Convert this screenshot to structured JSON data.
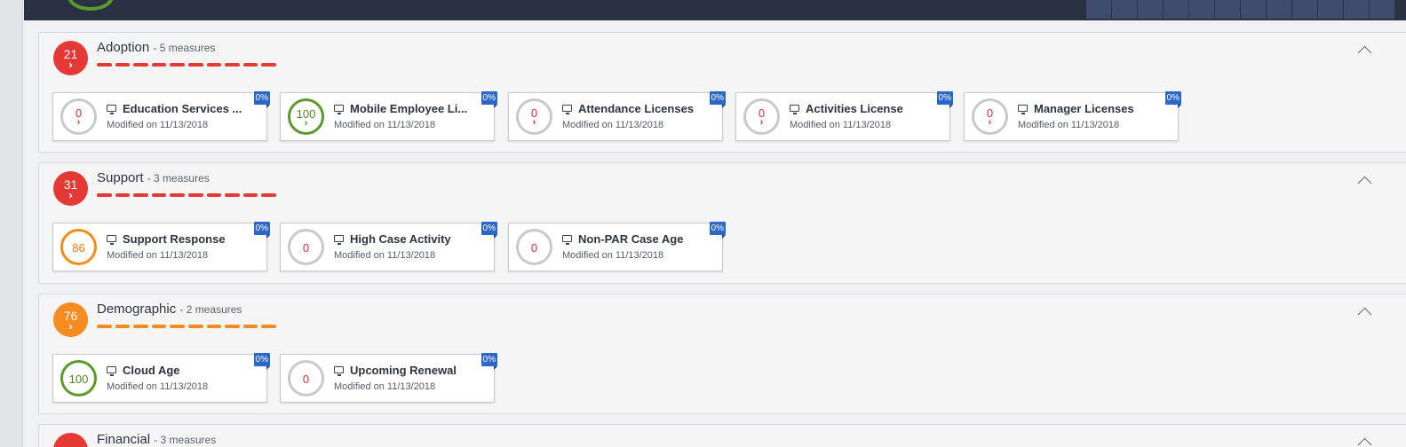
{
  "colors": {
    "red": "#e53935",
    "orange": "#f68b1f",
    "green": "#5b9a2e",
    "blue_tag": "#2a67c8"
  },
  "sections": [
    {
      "score": "21",
      "name": "Adoption",
      "measures": "- 5 measures",
      "color": "#e53935",
      "cards": [
        {
          "score": "0",
          "title": "Education Services ...",
          "modified": "Modified on 11/13/2018",
          "pct": "0%"
        },
        {
          "score": "100",
          "title": "Mobile Employee Li...",
          "modified": "Modified on 11/13/2018",
          "pct": "0%"
        },
        {
          "score": "0",
          "title": "Attendance Licenses",
          "modified": "Modified on 11/13/2018",
          "pct": "0%"
        },
        {
          "score": "0",
          "title": "Activities License",
          "modified": "Modified on 11/13/2018",
          "pct": "0%"
        },
        {
          "score": "0",
          "title": "Manager Licenses",
          "modified": "Modified on 11/13/2018",
          "pct": "0%"
        }
      ]
    },
    {
      "score": "31",
      "name": "Support",
      "measures": "- 3 measures",
      "color": "#e53935",
      "cards": [
        {
          "score": "86",
          "title": "Support Response",
          "modified": "Modified on 11/13/2018",
          "pct": "0%"
        },
        {
          "score": "0",
          "title": "High Case Activity",
          "modified": "Modified on 11/13/2018",
          "pct": "0%"
        },
        {
          "score": "0",
          "title": "Non-PAR Case Age",
          "modified": "Modified on 11/13/2018",
          "pct": "0%"
        }
      ]
    },
    {
      "score": "76",
      "name": "Demographic",
      "measures": "- 2 measures",
      "color": "#f68b1f",
      "cards": [
        {
          "score": "100",
          "title": "Cloud Age",
          "modified": "Modified on 11/13/2018",
          "pct": "0%"
        },
        {
          "score": "0",
          "title": "Upcoming Renewal",
          "modified": "Modified on 11/13/2018",
          "pct": "0%"
        }
      ]
    },
    {
      "name": "Financial",
      "measures": "- 3 measures",
      "color": "#e53935"
    }
  ]
}
